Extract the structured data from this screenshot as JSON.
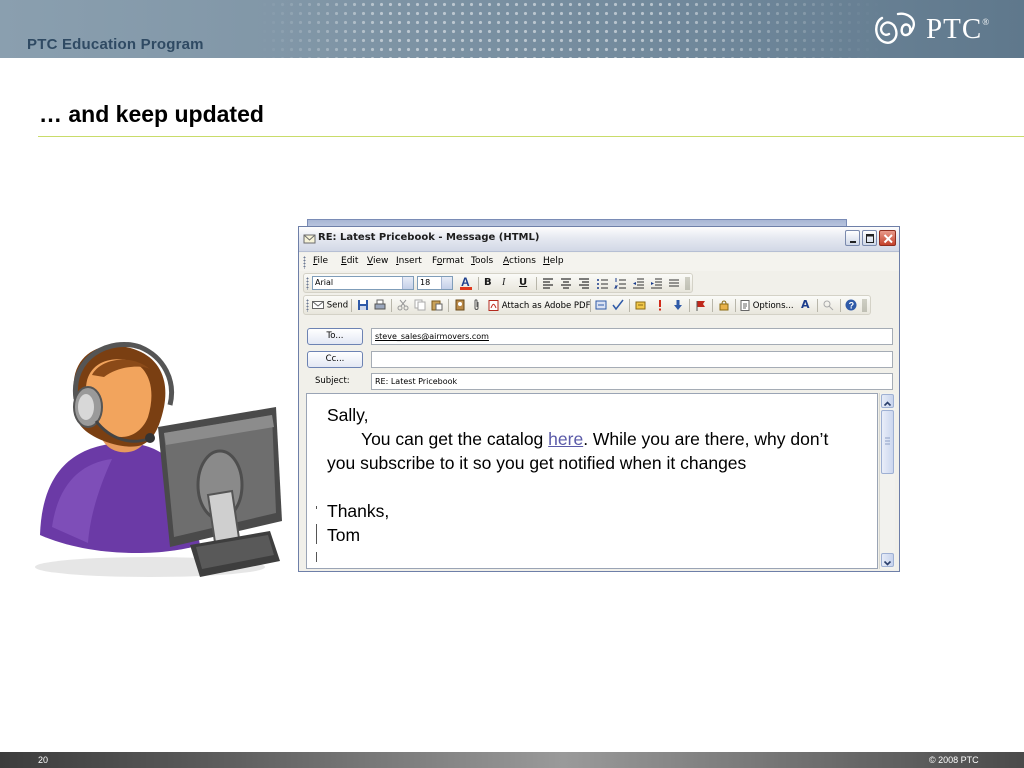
{
  "banner": {
    "program": "PTC Education Program",
    "logo_text": "PTC",
    "logo_reg": "®"
  },
  "slide": {
    "title": "… and keep updated",
    "page_number": "20",
    "copyright": "© 2008 PTC"
  },
  "window": {
    "title": "RE: Latest Pricebook - Message (HTML)",
    "menu": [
      "File",
      "Edit",
      "View",
      "Insert",
      "Format",
      "Tools",
      "Actions",
      "Help"
    ],
    "menu_access": [
      "F",
      "E",
      "V",
      "I",
      "o",
      "T",
      "A",
      "H"
    ],
    "font_name": "Arial",
    "font_size": "18",
    "format_buttons": {
      "bold": "B",
      "italic": "I",
      "underline": "U"
    },
    "toolbar": {
      "send": "Send",
      "attach_pdf": "Attach as Adobe PDF",
      "options": "Options...",
      "font_a": "A"
    }
  },
  "message": {
    "to_label": "To...",
    "cc_label": "Cc...",
    "subject_label": "Subject:",
    "to": "steve_sales@airmovers.com",
    "cc": "",
    "subject": "RE: Latest Pricebook",
    "greeting": "Sally,",
    "line1_before": "You can get the catalog ",
    "line1_link": "here",
    "line1_after": ". While you are there, why don’t you subscribe to it so you get notified when it changes",
    "closing": "Thanks,",
    "signature": "Tom"
  },
  "colors": {
    "banner": "#7d93a4",
    "title_rule": "#c9dc6a",
    "link": "#5a5aa8"
  }
}
